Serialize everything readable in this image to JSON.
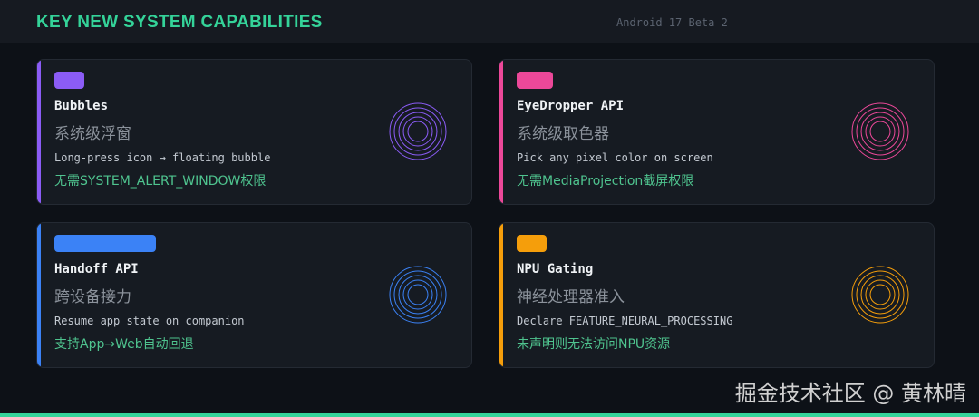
{
  "header": {
    "title": "KEY NEW SYSTEM CAPABILITIES",
    "version": "Android 17 Beta 2"
  },
  "cards": [
    {
      "title": "Bubbles",
      "subtitle_zh": "系统级浮窗",
      "desc": "Long-press icon → floating bubble",
      "note": "无需SYSTEM_ALERT_WINDOW权限",
      "color": "#8b5cf6"
    },
    {
      "title": "EyeDropper API",
      "subtitle_zh": "系统级取色器",
      "desc": "Pick any pixel color on screen",
      "note": "无需MediaProjection截屏权限",
      "color": "#ec4899"
    },
    {
      "title": "Handoff API",
      "subtitle_zh": "跨设备接力",
      "desc": "Resume app state on companion",
      "note": "支持App→Web自动回退",
      "color": "#3b82f6"
    },
    {
      "title": "NPU Gating",
      "subtitle_zh": "神经处理器准入",
      "desc": "Declare FEATURE_NEURAL_PROCESSING",
      "note": "未声明则无法访问NPU资源",
      "color": "#f59e0b"
    }
  ],
  "watermark": "掘金技术社区 @ 黄林晴"
}
